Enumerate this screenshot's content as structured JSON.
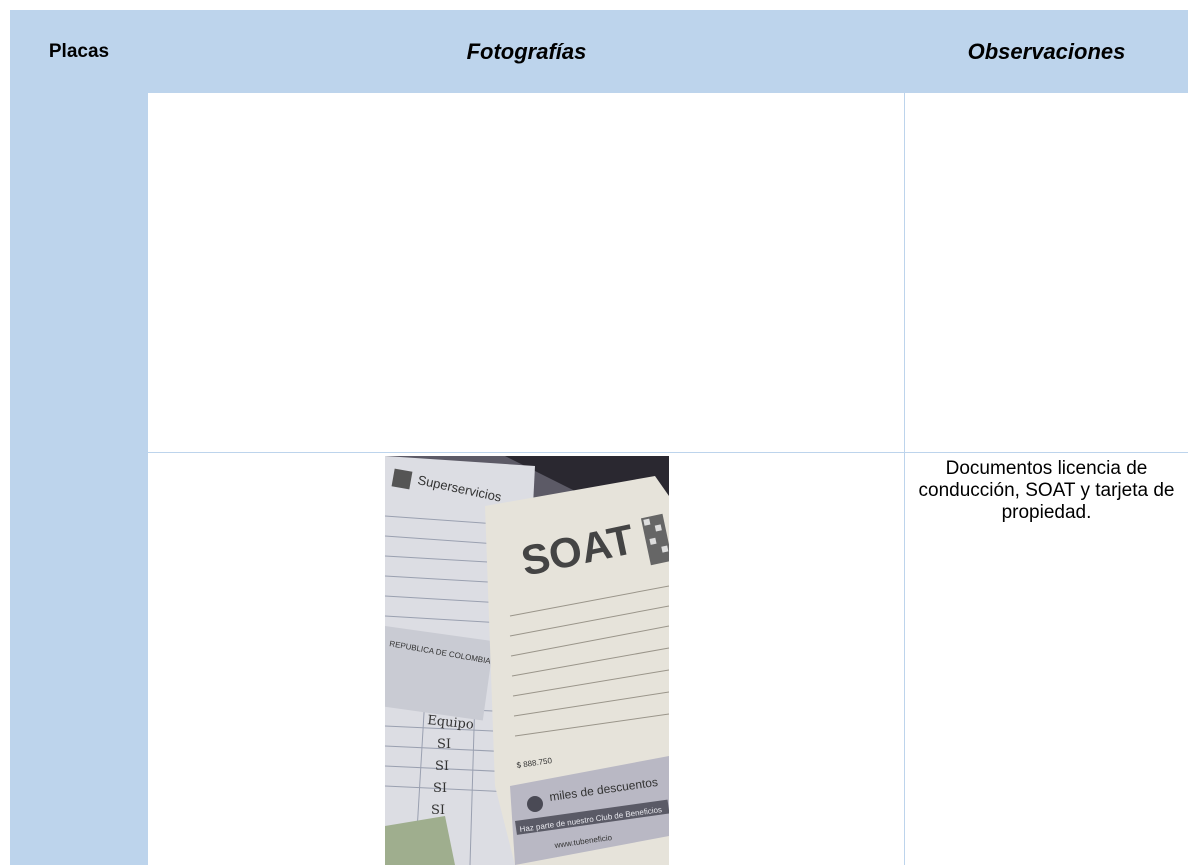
{
  "header": {
    "placas": "Placas",
    "fotografias": "Fotografías",
    "observaciones": "Observaciones"
  },
  "rows": [
    {
      "observacion": ""
    },
    {
      "observacion": "Documentos licencia de conducción, SOAT y tarjeta de propiedad."
    }
  ],
  "photo": {
    "superservicios": "Superservicios",
    "soat": "SOAT",
    "republica": "REPUBLICA DE COLOMBIA",
    "descuentos": "miles de descuentos",
    "club": "Haz parte de nuestro Club de Beneficios",
    "web": "www.tubeneficio",
    "amount": "$ 888.750",
    "handwriting": [
      "Equipo",
      "SI",
      "SI",
      "SI",
      "SI"
    ]
  },
  "colors": {
    "header_bg": "#bdd4ec",
    "grid_line": "#bdd4ec"
  }
}
